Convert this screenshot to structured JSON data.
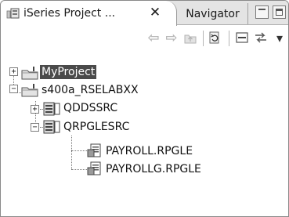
{
  "tabs": {
    "active": {
      "label": "iSeries Project ...",
      "close_glyph": "✕",
      "icon": "project-view-icon"
    },
    "inactive": {
      "label": "Navigator"
    }
  },
  "toolbar": {
    "back_glyph": "⇦",
    "forward_glyph": "⇨",
    "up_icon": "up-folder-icon",
    "refresh_icon": "refresh-icon",
    "collapse_icon": "collapse-all-icon",
    "link_icon": "link-with-editor-icon",
    "menu_glyph": "▾"
  },
  "tree": {
    "nodes": [
      {
        "label": "MyProject",
        "kind": "project",
        "expander": "+",
        "selected": true
      },
      {
        "label": "s400a_RSELABXX",
        "kind": "project",
        "expander": "−",
        "selected": false
      },
      {
        "label": "QDDSSRC",
        "kind": "source-file",
        "expander": "+",
        "selected": false
      },
      {
        "label": "QRPGLESRC",
        "kind": "source-file",
        "expander": "−",
        "selected": false
      },
      {
        "label": "PAYROLL.RPGLE",
        "kind": "member",
        "expander": "",
        "selected": false
      },
      {
        "label": "PAYROLLG.RPGLE",
        "kind": "member",
        "expander": "",
        "selected": false
      }
    ]
  }
}
